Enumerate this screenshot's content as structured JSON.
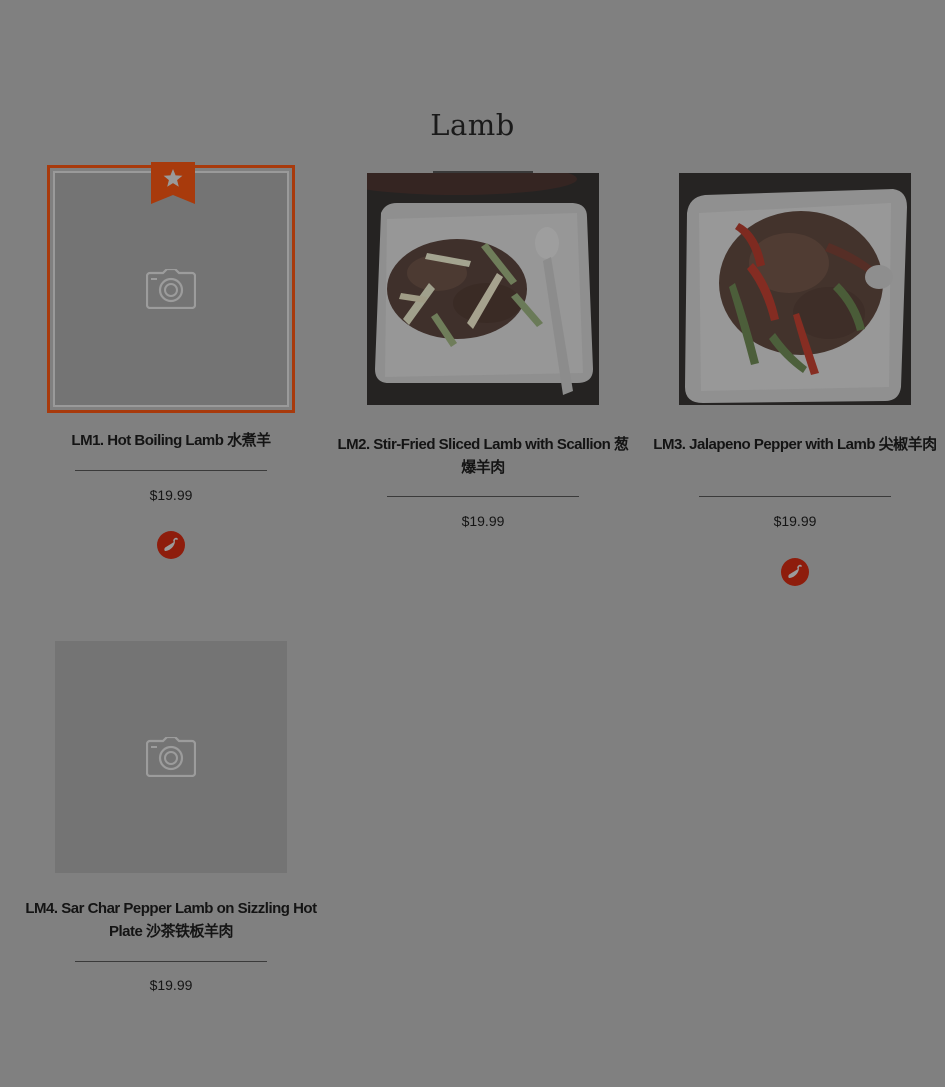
{
  "section": {
    "title": "Lamb"
  },
  "items": [
    {
      "name": "LM1. Hot Boiling Lamb 水煮羊",
      "price": "$19.99",
      "featured": true,
      "spicy": true,
      "image": "camera-placeholder-icon"
    },
    {
      "name": "LM2. Stir-Fried Sliced Lamb with Scallion 葱爆羊肉",
      "price": "$19.99",
      "featured": false,
      "spicy": false,
      "image": "food-photo"
    },
    {
      "name": "LM3. Jalapeno Pepper with Lamb 尖椒羊肉",
      "price": "$19.99",
      "featured": false,
      "spicy": true,
      "image": "food-photo"
    },
    {
      "name": "LM4. Sar Char Pepper Lamb on Sizzling Hot Plate 沙茶铁板羊肉",
      "price": "$19.99",
      "featured": false,
      "spicy": false,
      "image": "camera-placeholder-icon"
    }
  ],
  "colors": {
    "overlay_background": "#808080",
    "featured_accent": "#a83a0c",
    "spicy_badge": "#8e1d0c"
  },
  "icons": {
    "featured": "star-ribbon-icon",
    "spicy": "chili-pepper-icon",
    "no_image": "camera-icon"
  }
}
